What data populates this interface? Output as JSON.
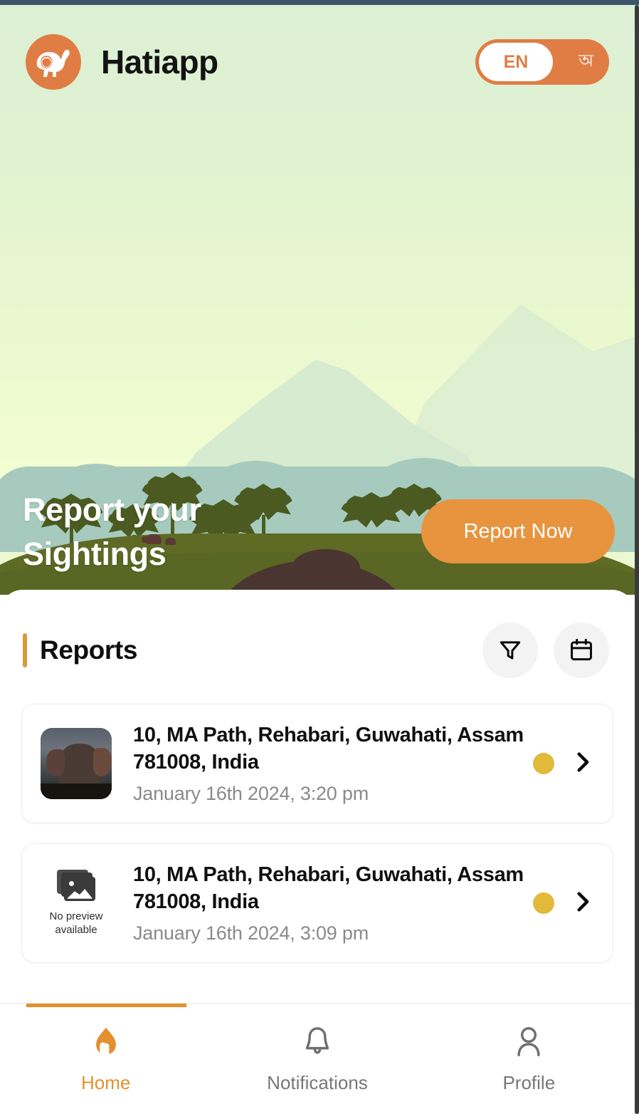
{
  "header": {
    "app_name": "Hatiapp",
    "logo_icon": "elephant-logo-icon",
    "language_toggle": {
      "active": "EN",
      "inactive": "অ"
    }
  },
  "hero": {
    "title_line1": "Report your",
    "title_line2": "Sightings",
    "cta_label": "Report Now"
  },
  "reports_section": {
    "title": "Reports",
    "filter_icon": "filter-funnel-icon",
    "calendar_icon": "calendar-icon",
    "items": [
      {
        "address": "10, MA Path, Rehabari, Guwahati, Assam 781008, India",
        "date": "January 16th 2024, 3:20 pm",
        "has_preview": true,
        "status_color": "#e2b93b",
        "chevron_icon": "chevron-right-icon"
      },
      {
        "address": "10, MA Path, Rehabari, Guwahati, Assam 781008, India",
        "date": "January 16th 2024, 3:09 pm",
        "has_preview": false,
        "no_preview_line1": "No preview",
        "no_preview_line2": "available",
        "status_color": "#e2b93b",
        "chevron_icon": "chevron-right-icon"
      }
    ]
  },
  "bottom_nav": {
    "items": [
      {
        "label": "Home",
        "icon": "home-icon",
        "active": true
      },
      {
        "label": "Notifications",
        "icon": "bell-icon",
        "active": false
      },
      {
        "label": "Profile",
        "icon": "person-icon",
        "active": false
      }
    ]
  },
  "colors": {
    "brand_orange": "#e07d45",
    "cta_orange": "#e8943f",
    "accent_amber": "#d79a3c",
    "status_amber": "#e2b93b",
    "nav_active": "#e3902f"
  }
}
